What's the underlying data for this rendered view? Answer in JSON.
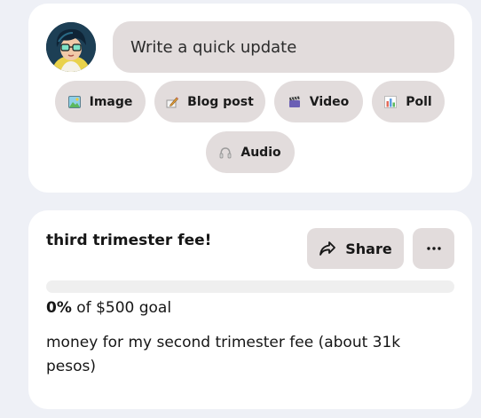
{
  "composer": {
    "input_placeholder": "Write a quick update",
    "avatar_icon": "avatar-illustration-icon",
    "post_types": [
      {
        "label": "Image",
        "icon": "image-icon"
      },
      {
        "label": "Blog post",
        "icon": "pencil-icon"
      },
      {
        "label": "Video",
        "icon": "clapperboard-icon"
      },
      {
        "label": "Poll",
        "icon": "bar-chart-icon"
      },
      {
        "label": "Audio",
        "icon": "headphones-icon"
      }
    ]
  },
  "goal": {
    "title": "third trimester fee!",
    "share_label": "Share",
    "more_icon": "ellipsis-icon",
    "progress_percent": 0,
    "percent_label": "0%",
    "goal_text": "of $500 goal",
    "description": "money for my second trimester fee (about 31k pesos)"
  },
  "colors": {
    "background": "#eef0f6",
    "card": "#ffffff",
    "button": "#e2dcdc",
    "progress_track": "#efefef"
  }
}
